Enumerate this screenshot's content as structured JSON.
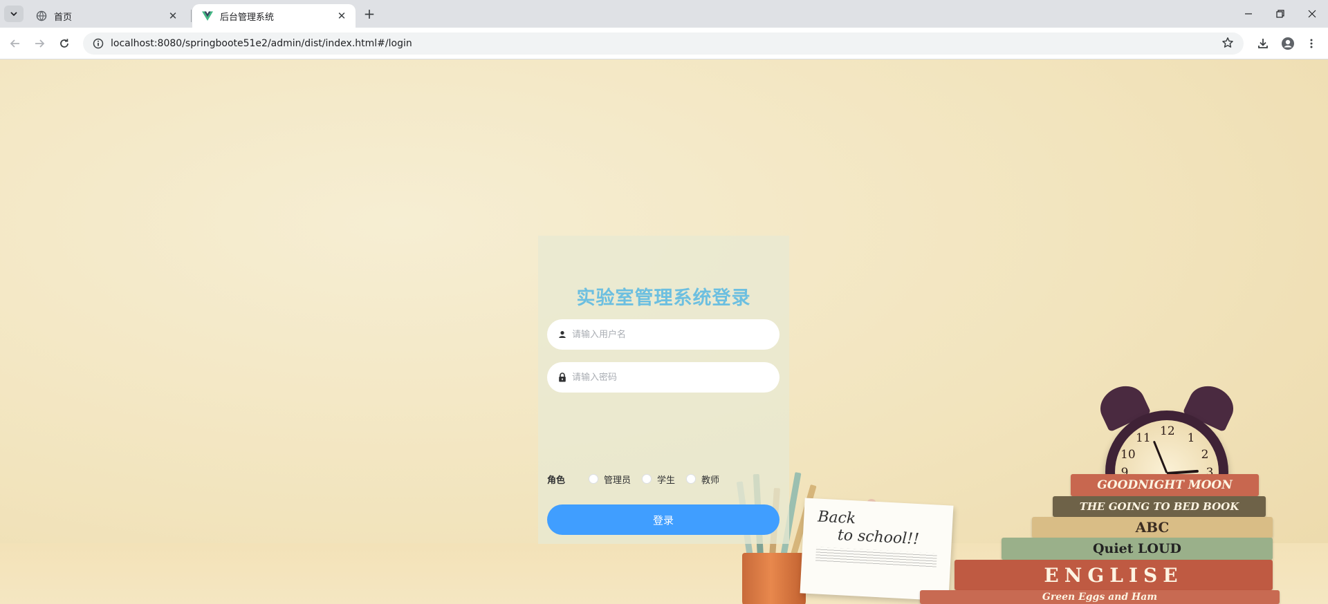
{
  "browser": {
    "tabs": [
      {
        "title": "首页",
        "active": false,
        "favicon": "globe-icon"
      },
      {
        "title": "后台管理系统",
        "active": true,
        "favicon": "vue-logo-icon"
      }
    ],
    "url": "localhost:8080/springboote51e2/admin/dist/index.html#/login"
  },
  "login": {
    "title": "实验室管理系统登录",
    "username_placeholder": "请输入用户名",
    "password_placeholder": "请输入密码",
    "role_label": "角色",
    "roles": [
      "管理员",
      "学生",
      "教师"
    ],
    "submit_label": "登录"
  },
  "decor": {
    "note_line1": "Back",
    "note_line2": "to school!!",
    "books": [
      "GOODNIGHT MOON",
      "THE GOING TO BED BOOK",
      "ABC",
      "Quiet LOUD",
      "ENGLISE",
      "Green Eggs and Ham"
    ]
  },
  "colors": {
    "title": "#6cbfe0",
    "button": "#409eff",
    "panel": "rgba(232,233,210,0.78)"
  }
}
